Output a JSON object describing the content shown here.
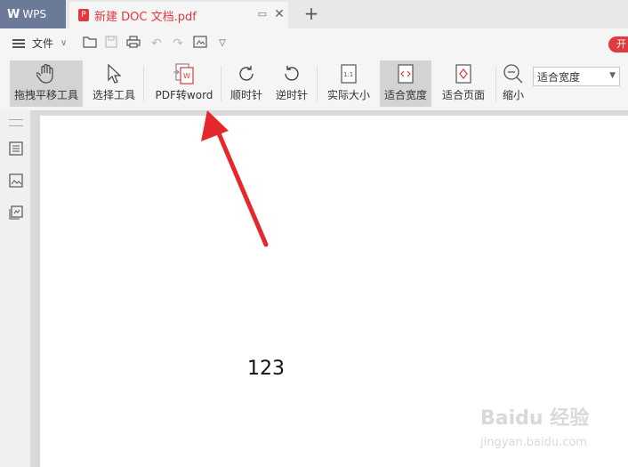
{
  "tabs": {
    "app_label": "WPS",
    "doc_title": "新建 DOC 文档.pdf",
    "pdf_badge": "P"
  },
  "menu": {
    "file_label": "文件",
    "start_badge": "开"
  },
  "toolbar": {
    "pan_tool": "拖拽平移工具",
    "select_tool": "选择工具",
    "pdf_to_word": "PDF转word",
    "rotate_cw": "顺时针",
    "rotate_ccw": "逆时针",
    "actual_size": "实际大小",
    "fit_width": "适合宽度",
    "fit_page": "适合页面",
    "zoom_out": "缩小",
    "zoom_select_value": "适合宽度"
  },
  "document": {
    "body_text": "123"
  },
  "watermark": {
    "brand": "Baidu 经验",
    "url": "jingyan.baidu.com"
  },
  "colors": {
    "accent_red": "#e0393e",
    "wps_tab": "#6b7a98"
  }
}
